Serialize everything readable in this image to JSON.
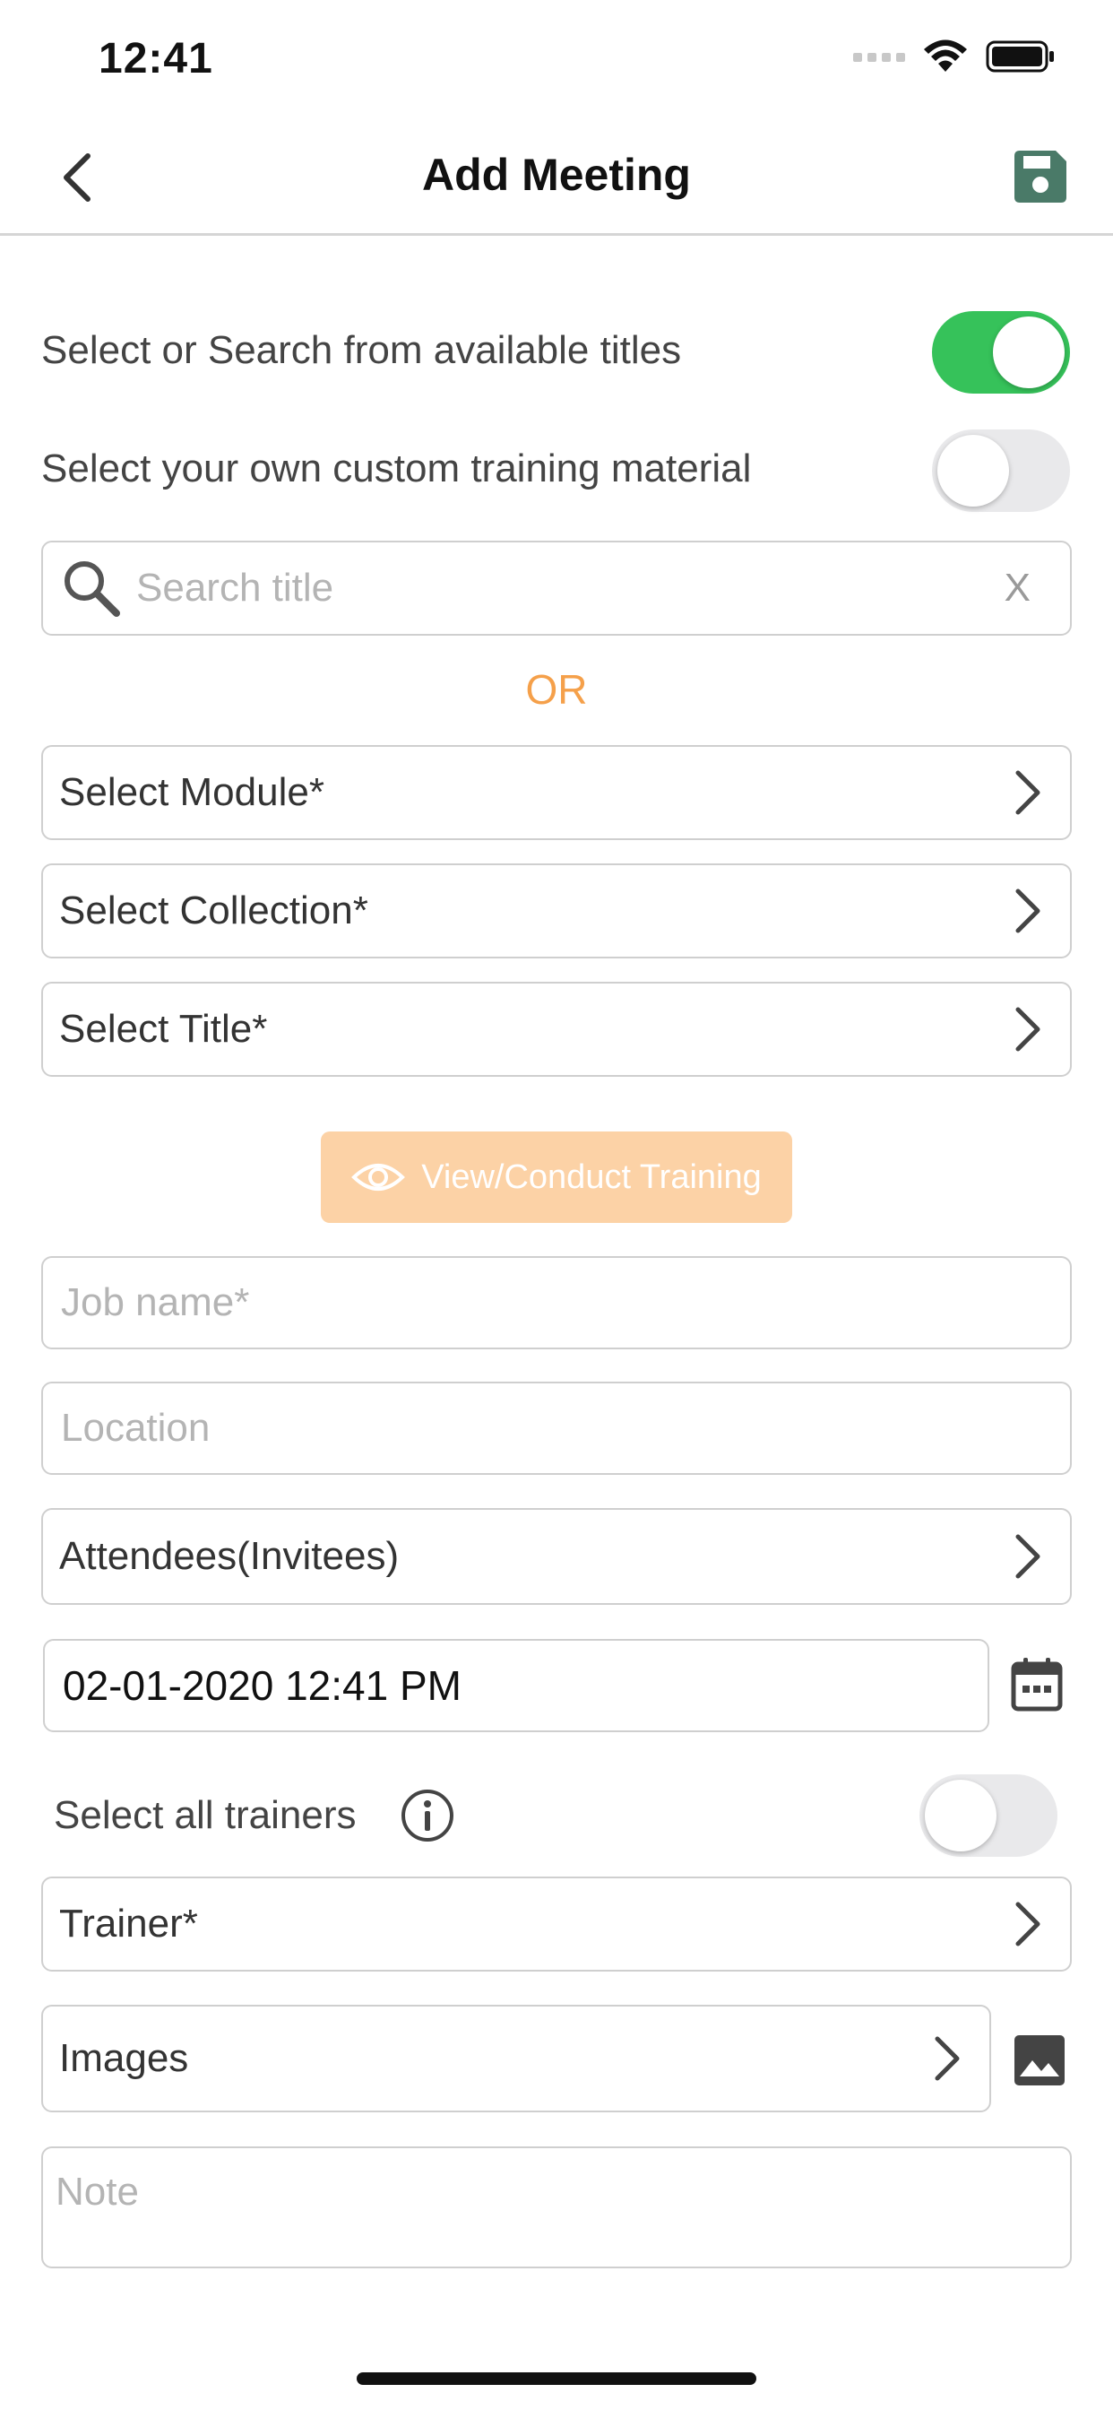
{
  "status_bar": {
    "time": "12:41"
  },
  "header": {
    "title": "Add Meeting"
  },
  "toggles": {
    "search_titles": {
      "label": "Select or Search from available titles",
      "on": true
    },
    "custom_material": {
      "label": "Select your own custom training material",
      "on": false
    },
    "all_trainers": {
      "label": "Select all trainers",
      "on": false
    }
  },
  "search": {
    "placeholder": "Search title",
    "clear_label": "X"
  },
  "or_label": "OR",
  "selectors": {
    "module": "Select Module*",
    "collection": "Select Collection*",
    "title": "Select Title*"
  },
  "view_button": {
    "label": "View/Conduct Training"
  },
  "inputs": {
    "job_name": {
      "placeholder": "Job name*"
    },
    "location": {
      "placeholder": "Location"
    },
    "note": {
      "placeholder": "Note"
    }
  },
  "attendees": {
    "label": "Attendees(Invitees)"
  },
  "datetime": {
    "value": "02-01-2020 12:41 PM"
  },
  "trainer": {
    "label": "Trainer*"
  },
  "images": {
    "label": "Images"
  },
  "colors": {
    "accent_green": "#36c25a",
    "save_icon": "#4a7a68",
    "or_orange": "#f5a04a",
    "button_disabled": "#fcd2a6"
  }
}
